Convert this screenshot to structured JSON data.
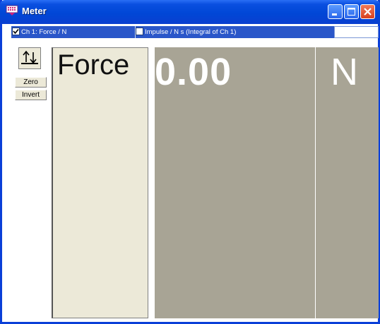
{
  "window": {
    "title": "Meter",
    "icon": "meter-app-icon",
    "controls": [
      "minimize-icon",
      "maximize-icon",
      "close-icon"
    ]
  },
  "channels": [
    {
      "label": "Ch 1: Force / N",
      "checked": true
    },
    {
      "label": "Impulse / N s (Integral of Ch 1)",
      "checked": false
    }
  ],
  "tools": {
    "icon": "zero-invert-icon",
    "zero_label": "Zero",
    "invert_label": "Invert"
  },
  "meter": {
    "label": "Force",
    "value": "0.00",
    "unit": "N"
  },
  "colors": {
    "titlebar": "#0047d6",
    "channel_bar": "#2a56c9",
    "label_panel": "#ece9d8",
    "value_panel": "#a8a495"
  }
}
